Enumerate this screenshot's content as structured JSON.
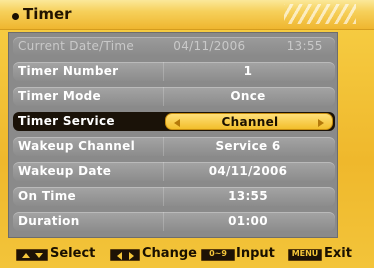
{
  "title": "Timer",
  "rows": [
    {
      "label": "Current Date/Time",
      "value": "04/11/2006          13:55",
      "state": "disabled"
    },
    {
      "label": "Timer Number",
      "value": "1",
      "state": "normal"
    },
    {
      "label": "Timer Mode",
      "value": "Once",
      "state": "normal"
    },
    {
      "label": "Timer Service",
      "value": "Channel",
      "state": "selected"
    },
    {
      "label": "Wakeup Channel",
      "value": "Service 6",
      "state": "normal"
    },
    {
      "label": "Wakeup Date",
      "value": "04/11/2006",
      "state": "normal"
    },
    {
      "label": "On Time",
      "value": "13:55",
      "state": "normal"
    },
    {
      "label": "Duration",
      "value": "01:00",
      "state": "normal"
    }
  ],
  "footer": {
    "select_label": "Select",
    "change_label": "Change",
    "input_key": "0~9",
    "input_label": "Input",
    "menu_key": "MENU",
    "exit_label": "Exit"
  },
  "colors": {
    "background": "#f4c63a",
    "panel": "#8a8a8a",
    "selected_row": "#1a1208",
    "selected_value": "#f2be2b"
  }
}
